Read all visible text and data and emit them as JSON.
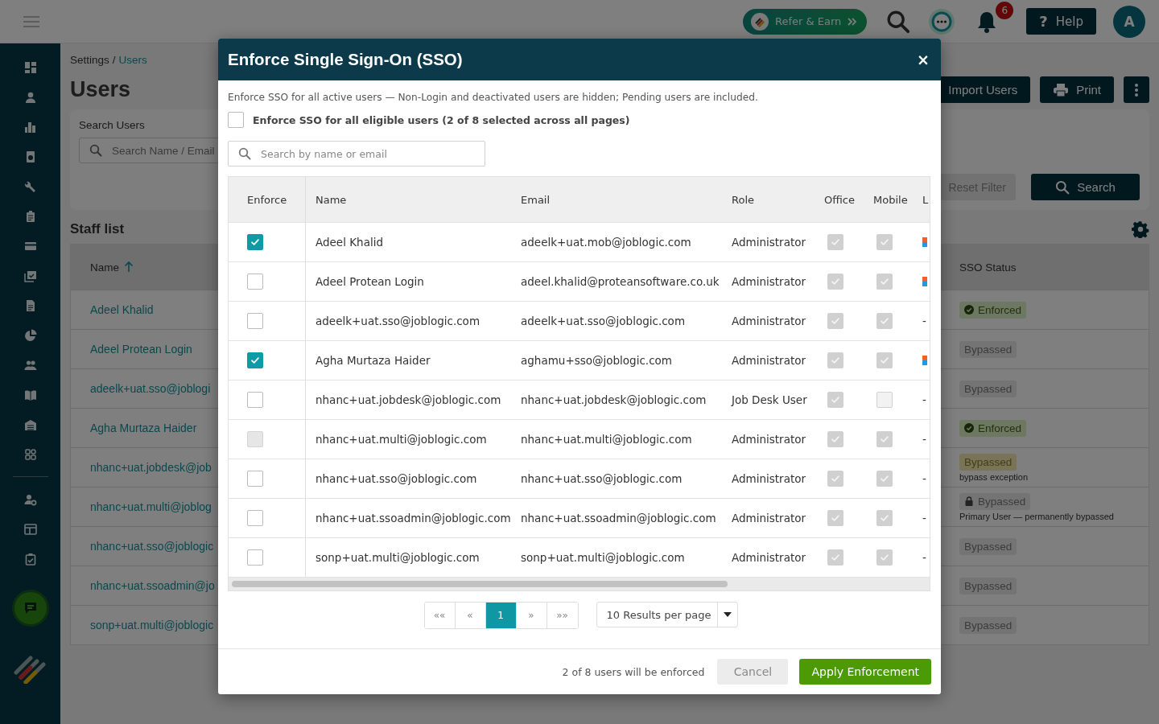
{
  "topbar": {
    "refer_button": "Refer & Earn",
    "notification_count": "6",
    "help_button": {
      "icon": "?",
      "label": "Help"
    },
    "avatar": "A"
  },
  "breadcrumb": {
    "parent": "Settings",
    "separator": "/",
    "current": "Users"
  },
  "page": {
    "title": "Users",
    "actions": [
      "Import Users",
      "Print"
    ]
  },
  "search_panel": {
    "label": "Search Users",
    "placeholder": "Search Name / Email",
    "reset_button": "Reset Filter",
    "search_button": "Search"
  },
  "staff_list": {
    "title": "Staff list",
    "columns": [
      {
        "label": "Name",
        "sorted": true
      },
      {
        "label": "SSO Status"
      }
    ],
    "rows": [
      {
        "name": "Adeel Khalid",
        "status": {
          "kind": "enforced",
          "label": "Enforced"
        }
      },
      {
        "name": "Adeel Protean Login",
        "status": {
          "kind": "bypassed",
          "label": "Bypassed"
        }
      },
      {
        "name": "adeelk+uat.sso@joblogi",
        "status": {
          "kind": "bypassed",
          "label": "Bypassed"
        }
      },
      {
        "name": "Agha Murtaza Haider",
        "status": {
          "kind": "enforced",
          "label": "Enforced"
        }
      },
      {
        "name": "nhanc+uat.jobdesk@job",
        "status": {
          "kind": "exception",
          "label": "Bypassed",
          "note": "bypass exception"
        }
      },
      {
        "name": "nhanc+uat.multi@joblog",
        "status": {
          "kind": "locked",
          "label": "Bypassed",
          "note": "Primary User — permanently bypassed"
        }
      },
      {
        "name": "nhanc+uat.sso@joblogic",
        "status": {
          "kind": "bypassed",
          "label": "Bypassed"
        }
      },
      {
        "name": "nhanc+uat.ssoadmin@jo",
        "status": {
          "kind": "bypassed",
          "label": "Bypassed"
        }
      },
      {
        "name": "sonp+uat.multi@joblogic",
        "status": {
          "kind": "bypassed",
          "label": "Bypassed"
        }
      }
    ]
  },
  "modal": {
    "title": "Enforce Single Sign-On (SSO)",
    "close": "×",
    "description": "Enforce SSO for all active users — Non-Login and deactivated users are hidden; Pending users are included.",
    "enforce_all": {
      "label": "Enforce SSO for all eligible users (2 of 8 selected across all pages)",
      "checked": false
    },
    "search": {
      "placeholder": "Search by name or email"
    },
    "columns": [
      "Enforce",
      "Name",
      "Email",
      "Role",
      "Office",
      "Mobile",
      "L"
    ],
    "rows": [
      {
        "enforce": {
          "checked": true,
          "disabled": false
        },
        "name": "Adeel Khalid",
        "email": "adeelk+uat.mob@joblogic.com",
        "role": "Administrator",
        "office": true,
        "mobile": true,
        "column_7": {
          "kind": "icon"
        }
      },
      {
        "enforce": {
          "checked": false,
          "disabled": false
        },
        "name": "Adeel Protean Login",
        "email": "adeel.khalid@proteansoftware.co.uk",
        "role": "Administrator",
        "office": true,
        "mobile": true,
        "column_7": {
          "kind": "icon"
        }
      },
      {
        "enforce": {
          "checked": false,
          "disabled": false
        },
        "name": "adeelk+uat.sso@joblogic.com",
        "email": "adeelk+uat.sso@joblogic.com",
        "role": "Administrator",
        "office": true,
        "mobile": true,
        "column_7": {
          "kind": "text",
          "text": "-"
        }
      },
      {
        "enforce": {
          "checked": true,
          "disabled": false
        },
        "name": "Agha Murtaza Haider",
        "email": "aghamu+sso@joblogic.com",
        "role": "Administrator",
        "office": true,
        "mobile": true,
        "column_7": {
          "kind": "icon"
        }
      },
      {
        "enforce": {
          "checked": false,
          "disabled": false
        },
        "name": "nhanc+uat.jobdesk@joblogic.com",
        "email": "nhanc+uat.jobdesk@joblogic.com",
        "role": "Job Desk User",
        "office": true,
        "mobile": false,
        "column_7": {
          "kind": "text",
          "text": "-"
        }
      },
      {
        "enforce": {
          "checked": false,
          "disabled": true
        },
        "name": "nhanc+uat.multi@joblogic.com",
        "email": "nhanc+uat.multi@joblogic.com",
        "role": "Administrator",
        "office": true,
        "mobile": true,
        "column_7": {
          "kind": "text",
          "text": "-"
        }
      },
      {
        "enforce": {
          "checked": false,
          "disabled": false
        },
        "name": "nhanc+uat.sso@joblogic.com",
        "email": "nhanc+uat.sso@joblogic.com",
        "role": "Administrator",
        "office": true,
        "mobile": true,
        "column_7": {
          "kind": "text",
          "text": "-"
        }
      },
      {
        "enforce": {
          "checked": false,
          "disabled": false
        },
        "name": "nhanc+uat.ssoadmin@joblogic.com",
        "email": "nhanc+uat.ssoadmin@joblogic.com",
        "role": "Administrator",
        "office": true,
        "mobile": true,
        "column_7": {
          "kind": "text",
          "text": "-"
        }
      },
      {
        "enforce": {
          "checked": false,
          "disabled": false
        },
        "name": "sonp+uat.multi@joblogic.com",
        "email": "sonp+uat.multi@joblogic.com",
        "role": "Administrator",
        "office": true,
        "mobile": true,
        "column_7": {
          "kind": "text",
          "text": "-"
        }
      }
    ],
    "pagination": [
      {
        "label": "««",
        "selected": false
      },
      {
        "label": "«",
        "selected": false
      },
      {
        "label": "1",
        "selected": true
      },
      {
        "label": "»",
        "selected": false
      },
      {
        "label": "»»",
        "selected": false
      }
    ],
    "per_page": "10 Results per page",
    "summary": "2 of 8 users will be enforced",
    "buttons": {
      "cancel": "Cancel",
      "apply": "Apply Enforcement"
    }
  }
}
